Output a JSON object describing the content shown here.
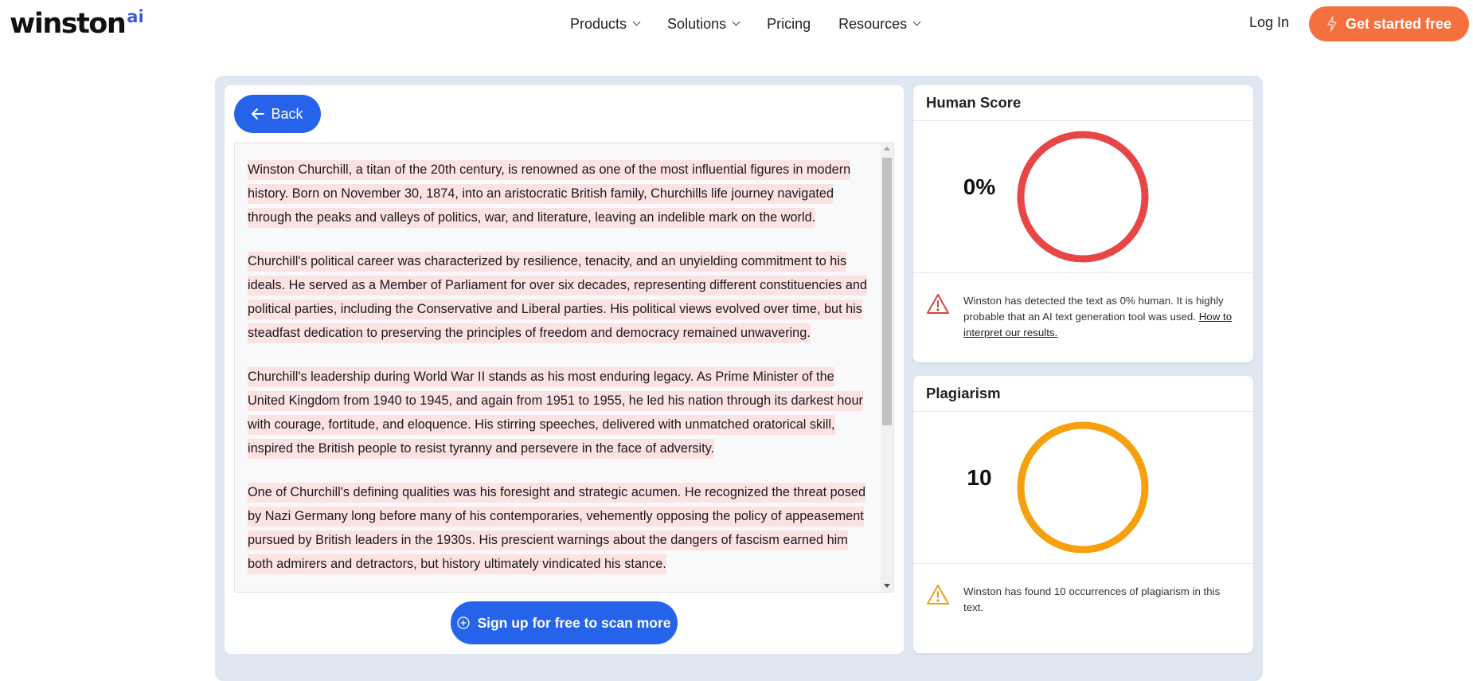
{
  "header": {
    "logo": {
      "word": "winston",
      "suffix": "ai",
      "suffix_color": "#3b5bdb"
    },
    "nav": [
      {
        "label": "Products",
        "has_dropdown": true
      },
      {
        "label": "Solutions",
        "has_dropdown": true
      },
      {
        "label": "Pricing",
        "has_dropdown": false
      },
      {
        "label": "Resources",
        "has_dropdown": true
      }
    ],
    "login_label": "Log In",
    "cta_label": "Get started free",
    "cta_icon": "lightning-icon",
    "cta_color": "#f4703f"
  },
  "editor": {
    "back_label": "Back",
    "back_icon": "arrow-left-icon",
    "highlight_color": "#fde2e2",
    "paragraphs": [
      "Winston Churchill, a titan of the 20th century, is renowned as one of the most influential figures in modern history. Born on November 30, 1874, into an aristocratic British family, Churchills life journey navigated through the peaks and valleys of politics, war, and literature, leaving an indelible mark on the world.",
      "Churchill's political career was characterized by resilience, tenacity, and an unyielding commitment to his ideals. He served as a Member of Parliament for over six decades, representing different constituencies and political parties, including the Conservative and Liberal parties. His political views evolved over time, but his steadfast dedication to preserving the principles of freedom and democracy remained unwavering.",
      "Churchill's leadership during World War II stands as his most enduring legacy. As Prime Minister of the United Kingdom from 1940 to 1945, and again from 1951 to 1955, he led his nation through its darkest hour with courage, fortitude, and eloquence. His stirring speeches, delivered with unmatched oratorical skill, inspired the British people to resist tyranny and persevere in the face of adversity.",
      "One of Churchill's defining qualities was his foresight and strategic acumen. He recognized the threat posed by Nazi Germany long before many of his contemporaries, vehemently opposing the policy of appeasement pursued by British leaders in the 1930s. His prescient warnings about the dangers of fascism earned him both admirers and detractors, but history ultimately vindicated his stance."
    ],
    "signup_label": "Sign up for free to scan more",
    "signup_icon": "plus-circle-icon",
    "button_color": "#2563eb"
  },
  "human_score": {
    "title": "Human Score",
    "value_display": "0%",
    "value_percent": 0,
    "ring_color": "#e84646",
    "warning_icon": "warning-triangle-icon",
    "warning_color": "#d64545",
    "message": "Winston has detected the text as 0% human. It is highly probable that an AI text generation tool was used.",
    "link_label": "How to interpret our results."
  },
  "plagiarism": {
    "title": "Plagiarism",
    "value_display": "10",
    "occurrences": 10,
    "ring_color": "#f5a00c",
    "warning_icon": "warning-triangle-icon",
    "warning_color": "#e8a317",
    "message": "Winston has found 10 occurrences of plagiarism in this text."
  }
}
